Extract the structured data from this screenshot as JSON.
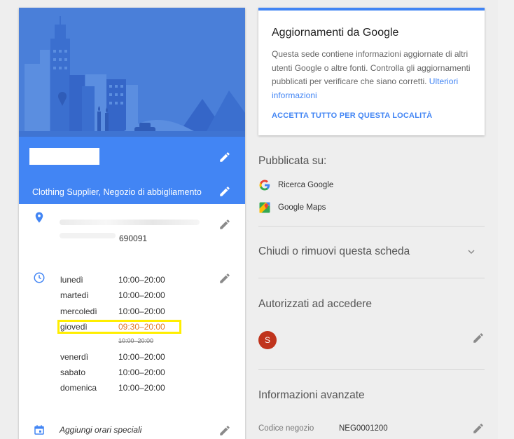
{
  "business": {
    "category": "Clothing Supplier, Negozio di abbigliamento",
    "postal_code": "690091"
  },
  "hours": [
    {
      "day": "lunedì",
      "time": "10:00–20:00"
    },
    {
      "day": "martedì",
      "time": "10:00–20:00"
    },
    {
      "day": "mercoledì",
      "time": "10:00–20:00"
    },
    {
      "day": "giovedì",
      "time": "09:30–20:00",
      "previous_time": "10:00–20:00"
    },
    {
      "day": "venerdì",
      "time": "10:00–20:00"
    },
    {
      "day": "sabato",
      "time": "10:00–20:00"
    },
    {
      "day": "domenica",
      "time": "10:00–20:00"
    }
  ],
  "special_hours_label": "Aggiungi orari speciali",
  "updates_card": {
    "title": "Aggiornamenti da Google",
    "body": "Questa sede contiene informazioni aggiornate di altri utenti Google o altre fonti. Controlla gli aggiornamenti pubblicati per verificare che siano corretti.",
    "link": "Ulteriori informazioni",
    "action": "ACCETTA TUTTO PER QUESTA LOCALITÀ"
  },
  "published": {
    "title": "Pubblicata su:",
    "platforms": [
      "Ricerca Google",
      "Google Maps"
    ]
  },
  "close_section": {
    "title": "Chiudi o rimuovi questa scheda"
  },
  "access_section": {
    "title": "Autorizzati ad accedere",
    "avatar_letter": "S"
  },
  "advanced_section": {
    "title": "Informazioni avanzate",
    "store_code_label": "Codice negozio",
    "store_code_value": "NEG0001200"
  },
  "colors": {
    "primary": "#4285f4",
    "hero": "#4a7fd9",
    "avatar": "#c0341d",
    "highlight": "#ffee00",
    "special_time": "#e07b2a"
  }
}
